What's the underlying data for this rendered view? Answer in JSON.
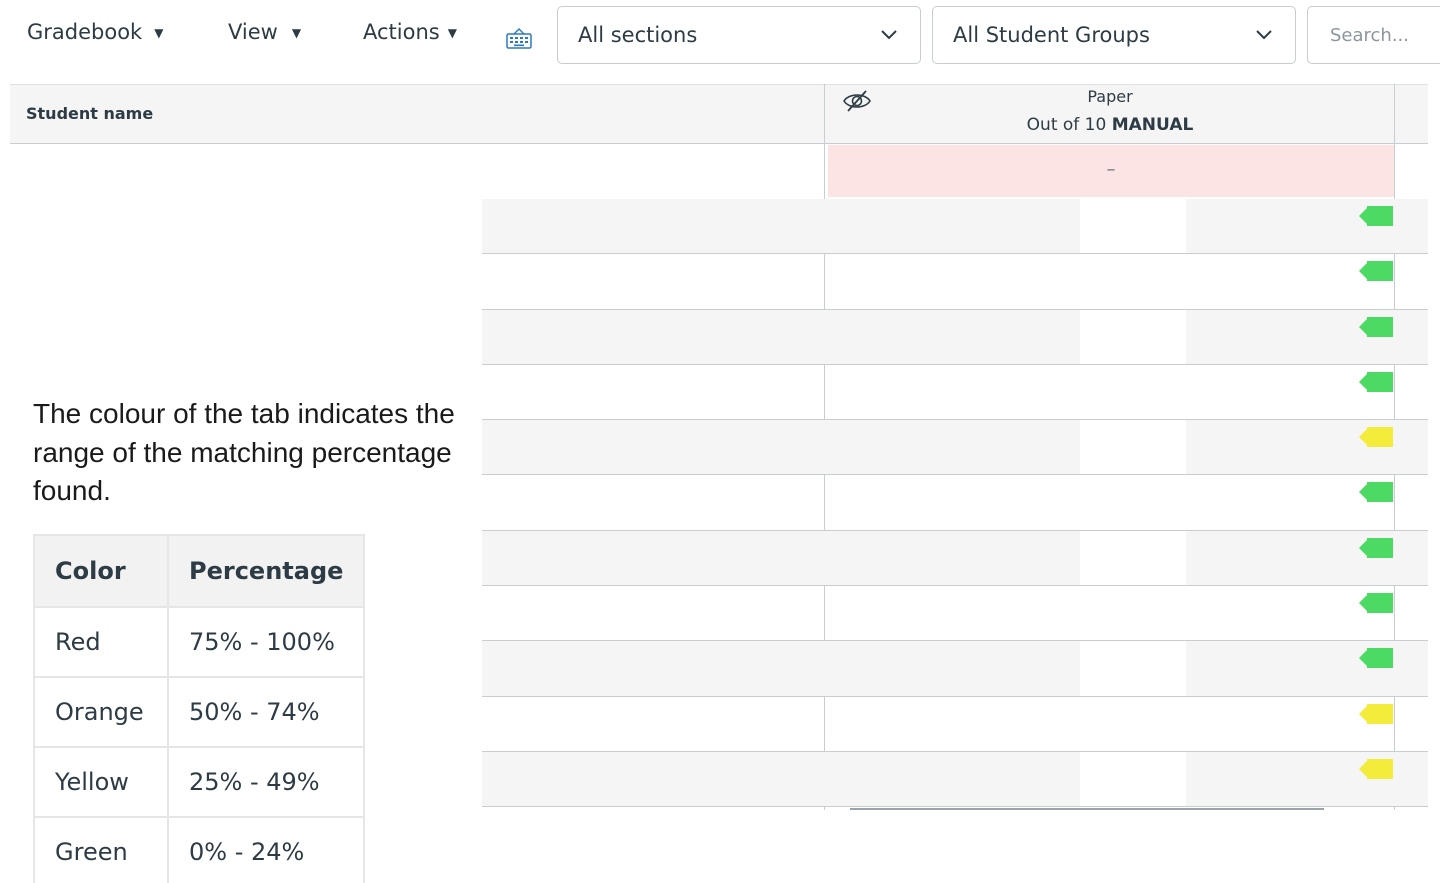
{
  "toolbar": {
    "menus": [
      {
        "label": "Gradebook"
      },
      {
        "label": "View"
      },
      {
        "label": "Actions"
      }
    ],
    "keyboard_icon": "keyboard-shortcuts-icon",
    "section_select": {
      "value": "All sections"
    },
    "group_select": {
      "value": "All Student Groups"
    },
    "search": {
      "placeholder": "Search..."
    }
  },
  "grid": {
    "student_column_label": "Student name",
    "assignment": {
      "title": "Paper",
      "points_prefix": "Out of 10",
      "grading_type": "MANUAL",
      "hidden_icon": "eye-off-icon"
    },
    "summary_row_value": "–",
    "tab_colors": {
      "green": "#4cd964",
      "yellow": "#f3ec3a"
    },
    "rows": [
      {
        "tab": "green"
      },
      {
        "tab": "green"
      },
      {
        "tab": "green"
      },
      {
        "tab": "green"
      },
      {
        "tab": "yellow"
      },
      {
        "tab": "green"
      },
      {
        "tab": "green"
      },
      {
        "tab": "green"
      },
      {
        "tab": "green"
      },
      {
        "tab": "yellow"
      },
      {
        "tab": "yellow"
      }
    ]
  },
  "explanation": "The colour of the tab indicates the range of the matching percentage found.",
  "legend": {
    "headers": [
      "Color",
      "Percentage"
    ],
    "rows": [
      [
        "Red",
        "75% - 100%"
      ],
      [
        "Orange",
        "50% - 74%"
      ],
      [
        "Yellow",
        "25% - 49%"
      ],
      [
        "Green",
        "0% - 24%"
      ]
    ]
  }
}
